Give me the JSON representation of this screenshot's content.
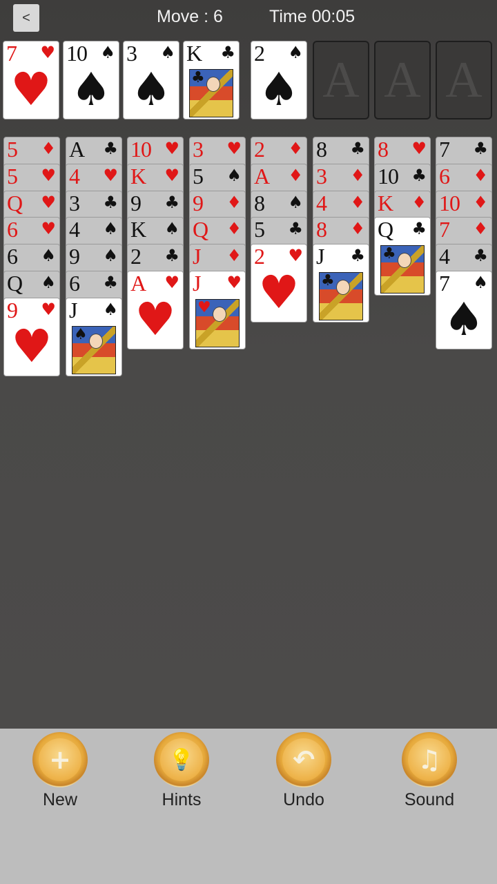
{
  "header": {
    "back_label": "<",
    "move_text": "Move : 6",
    "time_text": "Time 00:05"
  },
  "freecells": [
    {
      "rank": "7",
      "suit": "♥",
      "color": "red",
      "face": false
    },
    {
      "rank": "10",
      "suit": "♠",
      "color": "black",
      "face": false
    },
    {
      "rank": "3",
      "suit": "♠",
      "color": "black",
      "face": false
    },
    {
      "rank": "K",
      "suit": "♣",
      "color": "black",
      "face": true
    }
  ],
  "foundations": [
    {
      "card": {
        "rank": "2",
        "suit": "♠",
        "color": "black",
        "face": false
      }
    },
    {
      "placeholder": "A"
    },
    {
      "placeholder": "A"
    },
    {
      "placeholder": "A"
    }
  ],
  "tableau": [
    [
      {
        "rank": "5",
        "suit": "♦",
        "color": "red"
      },
      {
        "rank": "5",
        "suit": "♥",
        "color": "red"
      },
      {
        "rank": "Q",
        "suit": "♥",
        "color": "red"
      },
      {
        "rank": "6",
        "suit": "♥",
        "color": "red"
      },
      {
        "rank": "6",
        "suit": "♠",
        "color": "black"
      },
      {
        "rank": "Q",
        "suit": "♠",
        "color": "black"
      },
      {
        "rank": "9",
        "suit": "♥",
        "color": "red"
      }
    ],
    [
      {
        "rank": "A",
        "suit": "♣",
        "color": "black"
      },
      {
        "rank": "4",
        "suit": "♥",
        "color": "red"
      },
      {
        "rank": "3",
        "suit": "♣",
        "color": "black"
      },
      {
        "rank": "4",
        "suit": "♠",
        "color": "black"
      },
      {
        "rank": "9",
        "suit": "♠",
        "color": "black"
      },
      {
        "rank": "6",
        "suit": "♣",
        "color": "black"
      },
      {
        "rank": "J",
        "suit": "♠",
        "color": "black",
        "face": true
      }
    ],
    [
      {
        "rank": "10",
        "suit": "♥",
        "color": "red"
      },
      {
        "rank": "K",
        "suit": "♥",
        "color": "red"
      },
      {
        "rank": "9",
        "suit": "♣",
        "color": "black"
      },
      {
        "rank": "K",
        "suit": "♠",
        "color": "black"
      },
      {
        "rank": "2",
        "suit": "♣",
        "color": "black"
      },
      {
        "rank": "A",
        "suit": "♥",
        "color": "red"
      }
    ],
    [
      {
        "rank": "3",
        "suit": "♥",
        "color": "red"
      },
      {
        "rank": "5",
        "suit": "♠",
        "color": "black"
      },
      {
        "rank": "9",
        "suit": "♦",
        "color": "red"
      },
      {
        "rank": "Q",
        "suit": "♦",
        "color": "red"
      },
      {
        "rank": "J",
        "suit": "♦",
        "color": "red"
      },
      {
        "rank": "J",
        "suit": "♥",
        "color": "red",
        "face": true
      }
    ],
    [
      {
        "rank": "2",
        "suit": "♦",
        "color": "red"
      },
      {
        "rank": "A",
        "suit": "♦",
        "color": "red"
      },
      {
        "rank": "8",
        "suit": "♠",
        "color": "black"
      },
      {
        "rank": "5",
        "suit": "♣",
        "color": "black"
      },
      {
        "rank": "2",
        "suit": "♥",
        "color": "red"
      }
    ],
    [
      {
        "rank": "8",
        "suit": "♣",
        "color": "black"
      },
      {
        "rank": "3",
        "suit": "♦",
        "color": "red"
      },
      {
        "rank": "4",
        "suit": "♦",
        "color": "red"
      },
      {
        "rank": "8",
        "suit": "♦",
        "color": "red"
      },
      {
        "rank": "J",
        "suit": "♣",
        "color": "black",
        "face": true
      }
    ],
    [
      {
        "rank": "8",
        "suit": "♥",
        "color": "red"
      },
      {
        "rank": "10",
        "suit": "♣",
        "color": "black"
      },
      {
        "rank": "K",
        "suit": "♦",
        "color": "red"
      },
      {
        "rank": "Q",
        "suit": "♣",
        "color": "black",
        "face": true
      }
    ],
    [
      {
        "rank": "7",
        "suit": "♣",
        "color": "black"
      },
      {
        "rank": "6",
        "suit": "♦",
        "color": "red"
      },
      {
        "rank": "10",
        "suit": "♦",
        "color": "red"
      },
      {
        "rank": "7",
        "suit": "♦",
        "color": "red"
      },
      {
        "rank": "4",
        "suit": "♣",
        "color": "black"
      },
      {
        "rank": "7",
        "suit": "♠",
        "color": "black"
      }
    ]
  ],
  "toolbar": {
    "buttons": [
      {
        "label": "New",
        "icon": "plus-icon",
        "glyph": "+"
      },
      {
        "label": "Hints",
        "icon": "lightbulb-icon",
        "glyph": "💡"
      },
      {
        "label": "Undo",
        "icon": "undo-icon",
        "glyph": "↶"
      },
      {
        "label": "Sound",
        "icon": "music-note-icon",
        "glyph": "♫"
      }
    ]
  },
  "colors": {
    "red_suit": "#e01717",
    "black_suit": "#111111",
    "button_gold": "#e6a93b"
  }
}
